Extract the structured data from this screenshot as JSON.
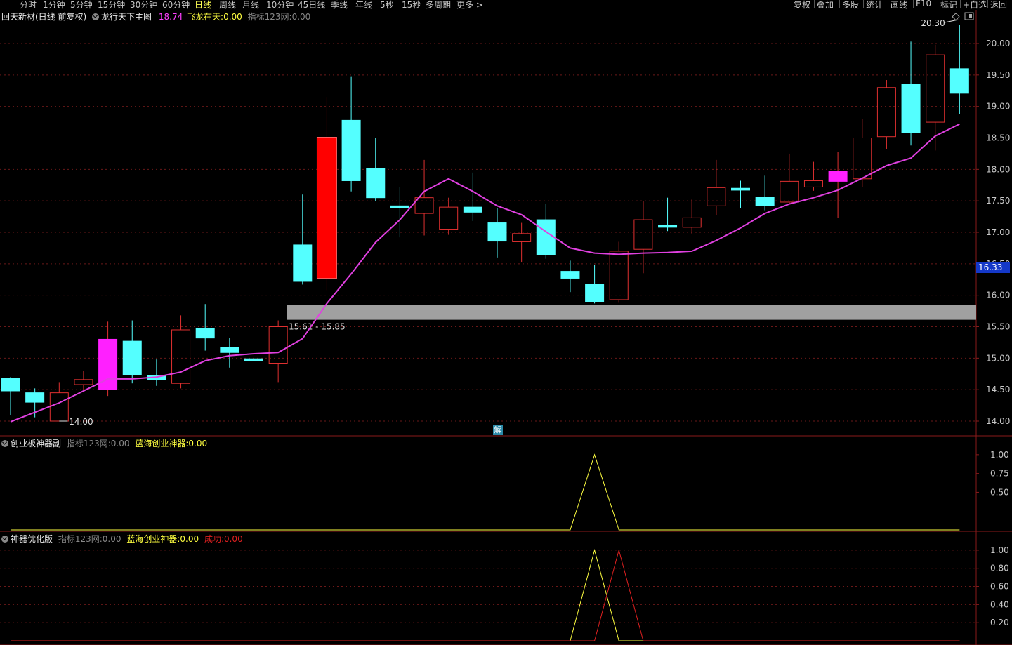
{
  "toolbar": {
    "left_items": [
      "分时",
      "1分钟",
      "5分钟",
      "15分钟",
      "30分钟",
      "60分钟",
      "日线",
      "周线",
      "月线",
      "10分钟",
      "45日线",
      "季线",
      "年线",
      "5秒",
      "15秒",
      "多周期",
      "更多 >"
    ],
    "active": "日线",
    "right_items": [
      "复权",
      "叠加",
      "多股",
      "统计",
      "画线",
      "F10",
      "标记",
      "+自选",
      "返回"
    ]
  },
  "main_panel": {
    "title": "回天新材(日线 前复权)",
    "indicator": "龙行天下主图",
    "value1": "18.74",
    "label2": "飞龙在天:",
    "value2": "0.00",
    "label3": "指标123网:",
    "value3": "0.00",
    "current_price": "16.33",
    "high_label": "20.30",
    "low_label": "14.00",
    "band_label": "15.61 - 15.85",
    "marker": "解"
  },
  "sub1": {
    "title": "创业板神器副",
    "label1": "指标123网:",
    "value1": "0.00",
    "label2": "蓝海创业神器:",
    "value2": "0.00"
  },
  "sub2": {
    "title": "神器优化版",
    "label1": "指标123网:",
    "value1": "0.00",
    "label2": "蓝海创业神器:",
    "value2": "0.00",
    "label3": "成功:",
    "value3": "0.00"
  },
  "colors": {
    "up": "#e03030",
    "down": "#54ffff",
    "limit_up": "#ff0000",
    "special": "#ff20ff",
    "ma": "#e040e0",
    "band": "#a0a0a0",
    "yellow": "#ffff40",
    "red_line": "#e02020"
  },
  "chart_data": [
    {
      "type": "candlestick",
      "ylim": [
        13.85,
        20.3
      ],
      "yticks": [
        "14.00",
        "14.50",
        "15.00",
        "15.50",
        "16.00",
        "16.50",
        "17.00",
        "17.50",
        "18.00",
        "18.50",
        "19.00",
        "19.50",
        "20.00"
      ],
      "candles": [
        {
          "o": 14.68,
          "c": 14.48,
          "h": 14.7,
          "l": 14.1,
          "dir": "down"
        },
        {
          "o": 14.45,
          "c": 14.3,
          "h": 14.52,
          "l": 14.06,
          "dir": "down"
        },
        {
          "o": 14.0,
          "c": 14.45,
          "h": 14.62,
          "l": 14.0,
          "dir": "up"
        },
        {
          "o": 14.58,
          "c": 14.66,
          "h": 14.8,
          "l": 14.5,
          "dir": "up"
        },
        {
          "o": 14.5,
          "c": 15.3,
          "h": 15.58,
          "l": 14.4,
          "dir": "special"
        },
        {
          "o": 15.27,
          "c": 14.74,
          "h": 15.6,
          "l": 14.6,
          "dir": "down"
        },
        {
          "o": 14.73,
          "c": 14.66,
          "h": 14.98,
          "l": 14.56,
          "dir": "down"
        },
        {
          "o": 14.6,
          "c": 15.45,
          "h": 15.68,
          "l": 14.52,
          "dir": "up"
        },
        {
          "o": 15.47,
          "c": 15.32,
          "h": 15.86,
          "l": 15.12,
          "dir": "down"
        },
        {
          "o": 15.17,
          "c": 15.09,
          "h": 15.32,
          "l": 14.85,
          "dir": "down"
        },
        {
          "o": 14.99,
          "c": 14.96,
          "h": 15.38,
          "l": 14.86,
          "dir": "down"
        },
        {
          "o": 14.92,
          "c": 15.5,
          "h": 15.6,
          "l": 14.62,
          "dir": "up"
        },
        {
          "o": 16.8,
          "c": 16.22,
          "h": 17.6,
          "l": 16.17,
          "dir": "down"
        },
        {
          "o": 16.28,
          "c": 18.5,
          "h": 19.15,
          "l": 16.08,
          "dir": "limit"
        },
        {
          "o": 18.78,
          "c": 17.82,
          "h": 19.48,
          "l": 17.65,
          "dir": "down"
        },
        {
          "o": 18.02,
          "c": 17.55,
          "h": 18.5,
          "l": 17.5,
          "dir": "down"
        },
        {
          "o": 17.42,
          "c": 17.39,
          "h": 17.72,
          "l": 16.92,
          "dir": "down"
        },
        {
          "o": 17.3,
          "c": 17.55,
          "h": 18.15,
          "l": 16.95,
          "dir": "up"
        },
        {
          "o": 17.05,
          "c": 17.4,
          "h": 17.55,
          "l": 16.96,
          "dir": "up"
        },
        {
          "o": 17.4,
          "c": 17.32,
          "h": 17.95,
          "l": 17.18,
          "dir": "down"
        },
        {
          "o": 17.15,
          "c": 16.86,
          "h": 17.38,
          "l": 16.6,
          "dir": "down"
        },
        {
          "o": 16.85,
          "c": 16.98,
          "h": 17.15,
          "l": 16.52,
          "dir": "up"
        },
        {
          "o": 17.2,
          "c": 16.64,
          "h": 17.45,
          "l": 16.58,
          "dir": "down"
        },
        {
          "o": 16.38,
          "c": 16.27,
          "h": 16.55,
          "l": 16.05,
          "dir": "down"
        },
        {
          "o": 16.17,
          "c": 15.9,
          "h": 16.48,
          "l": 15.87,
          "dir": "down"
        },
        {
          "o": 15.93,
          "c": 16.7,
          "h": 16.85,
          "l": 15.88,
          "dir": "up"
        },
        {
          "o": 16.73,
          "c": 17.2,
          "h": 17.5,
          "l": 16.35,
          "dir": "up"
        },
        {
          "o": 17.11,
          "c": 17.08,
          "h": 17.55,
          "l": 17.02,
          "dir": "down"
        },
        {
          "o": 17.08,
          "c": 17.23,
          "h": 17.52,
          "l": 16.98,
          "dir": "up"
        },
        {
          "o": 17.42,
          "c": 17.71,
          "h": 18.15,
          "l": 17.27,
          "dir": "up"
        },
        {
          "o": 17.7,
          "c": 17.67,
          "h": 17.82,
          "l": 17.38,
          "dir": "down"
        },
        {
          "o": 17.56,
          "c": 17.42,
          "h": 17.9,
          "l": 17.35,
          "dir": "down"
        },
        {
          "o": 17.48,
          "c": 17.81,
          "h": 18.25,
          "l": 17.45,
          "dir": "up"
        },
        {
          "o": 17.72,
          "c": 17.82,
          "h": 18.12,
          "l": 17.66,
          "dir": "up"
        },
        {
          "o": 17.81,
          "c": 17.97,
          "h": 18.28,
          "l": 17.23,
          "dir": "special"
        },
        {
          "o": 17.85,
          "c": 18.5,
          "h": 18.8,
          "l": 17.72,
          "dir": "up"
        },
        {
          "o": 18.52,
          "c": 19.3,
          "h": 19.42,
          "l": 18.32,
          "dir": "up"
        },
        {
          "o": 19.35,
          "c": 18.58,
          "h": 20.03,
          "l": 18.38,
          "dir": "down"
        },
        {
          "o": 18.75,
          "c": 19.82,
          "h": 19.98,
          "l": 18.3,
          "dir": "up"
        },
        {
          "o": 19.6,
          "c": 19.21,
          "h": 20.3,
          "l": 18.88,
          "dir": "down"
        }
      ],
      "ma": [
        13.99,
        14.14,
        14.29,
        14.48,
        14.67,
        14.67,
        14.7,
        14.78,
        14.96,
        15.04,
        15.07,
        15.09,
        15.31,
        15.87,
        16.34,
        16.84,
        17.2,
        17.65,
        17.85,
        17.65,
        17.42,
        17.28,
        17.01,
        16.75,
        16.67,
        16.65,
        16.67,
        16.68,
        16.7,
        16.87,
        17.07,
        17.3,
        17.45,
        17.55,
        17.67,
        17.86,
        18.06,
        18.18,
        18.53,
        18.72
      ],
      "band": [
        15.61,
        15.85
      ]
    },
    {
      "type": "line",
      "ylim": [
        0,
        1.12
      ],
      "yticks": [
        "0.50",
        "0.75",
        "1.00"
      ],
      "series": [
        {
          "values": [
            0,
            0,
            0,
            0,
            0,
            0,
            0,
            0,
            0,
            0,
            0,
            0,
            0,
            0,
            0,
            0,
            0,
            0,
            0,
            0,
            0,
            0,
            0,
            0,
            1,
            0,
            0,
            0,
            0,
            0,
            0,
            0,
            0,
            0,
            0,
            0,
            0,
            0,
            0,
            0
          ],
          "color": "yellow"
        }
      ]
    },
    {
      "type": "line",
      "ylim": [
        0,
        1.1
      ],
      "yticks": [
        "0.20",
        "0.40",
        "0.60",
        "0.80",
        "1.00"
      ],
      "series": [
        {
          "values": [
            0,
            0,
            0,
            0,
            0,
            0,
            0,
            0,
            0,
            0,
            0,
            0,
            0,
            0,
            0,
            0,
            0,
            0,
            0,
            0,
            0,
            0,
            0,
            0,
            1,
            0,
            0,
            0,
            0,
            0,
            0,
            0,
            0,
            0,
            0,
            0,
            0,
            0,
            0,
            0
          ],
          "color": "yellow"
        },
        {
          "values": [
            0,
            0,
            0,
            0,
            0,
            0,
            0,
            0,
            0,
            0,
            0,
            0,
            0,
            0,
            0,
            0,
            0,
            0,
            0,
            0,
            0,
            0,
            0,
            0,
            0,
            1,
            0,
            0,
            0,
            0,
            0,
            0,
            0,
            0,
            0,
            0,
            0,
            0,
            0,
            0
          ],
          "color": "red"
        }
      ]
    }
  ]
}
